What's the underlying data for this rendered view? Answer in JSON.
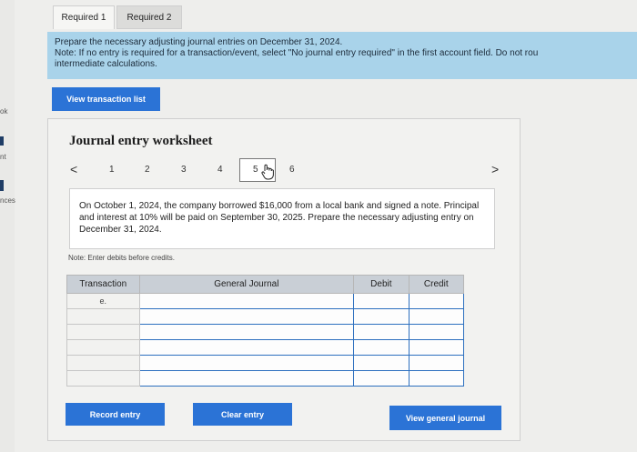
{
  "sidebar": {
    "labels": [
      "ok",
      "nt",
      "nces"
    ]
  },
  "tabs": [
    {
      "label": "Required 1"
    },
    {
      "label": "Required 2"
    }
  ],
  "instructions": {
    "line1": "Prepare the necessary adjusting journal entries on December 31, 2024.",
    "line2": "Note: If no entry is required for a transaction/event, select \"No journal entry required\" in the first account field. Do not rou",
    "line3": "intermediate calculations."
  },
  "buttons": {
    "view_transaction_list": "View transaction list",
    "record_entry": "Record entry",
    "clear_entry": "Clear entry",
    "view_general_journal": "View general journal"
  },
  "worksheet": {
    "title": "Journal entry worksheet",
    "pages": [
      "1",
      "2",
      "3",
      "4",
      "5",
      "6"
    ],
    "active_page": "5",
    "left_arrow": "<",
    "right_arrow": ">",
    "description": "On October 1, 2024, the company borrowed $16,000 from a local bank and signed a note. Principal and interest at 10% will be paid on September 30, 2025. Prepare the necessary adjusting entry on December 31, 2024.",
    "note": "Note: Enter debits before credits.",
    "table": {
      "headers": [
        "Transaction",
        "General Journal",
        "Debit",
        "Credit"
      ],
      "transaction": "e."
    }
  },
  "colors": {
    "accent_blue": "#2b73d6",
    "instruction_bg": "#a9d3ea",
    "table_header_bg": "#c9cfd6"
  }
}
